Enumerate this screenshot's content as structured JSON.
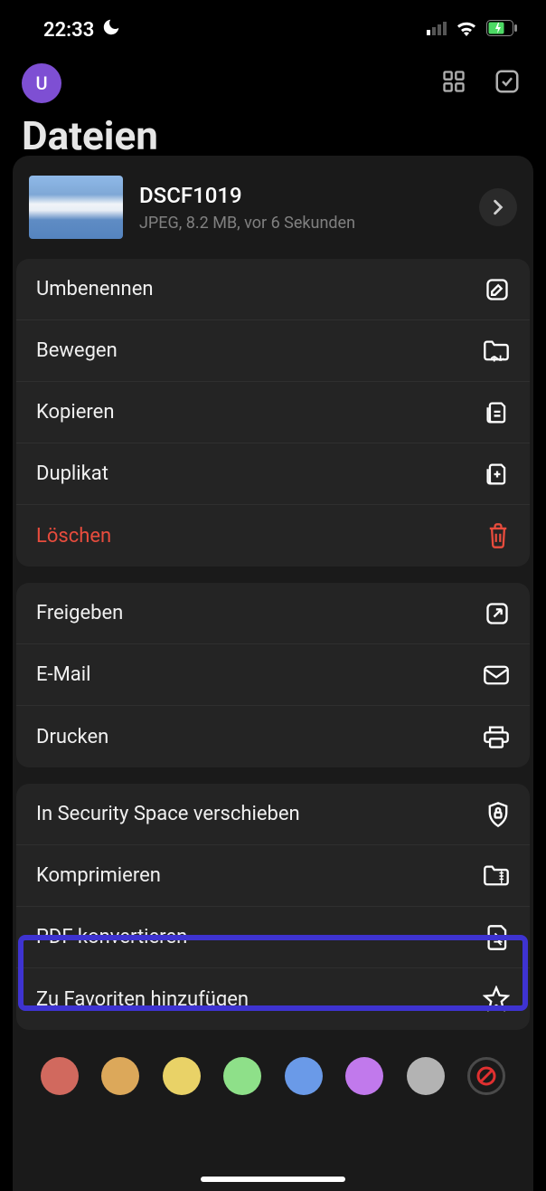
{
  "status": {
    "time": "22:33"
  },
  "avatar_letter": "U",
  "page_title": "Dateien",
  "file": {
    "name": "DSCF1019",
    "meta": "JPEG, 8.2 MB, vor 6 Sekunden"
  },
  "group1": {
    "rename": "Umbenennen",
    "move": "Bewegen",
    "copy": "Kopieren",
    "duplicate": "Duplikat",
    "delete": "Löschen"
  },
  "group2": {
    "share": "Freigeben",
    "email": "E-Mail",
    "print": "Drucken"
  },
  "group3": {
    "security": "In Security Space verschieben",
    "compress": "Komprimieren",
    "pdf": "PDF konvertieren",
    "favorite": "Zu Favoriten hinzufügen"
  },
  "colors": [
    "#d1695e",
    "#dca85a",
    "#e9d267",
    "#8ee089",
    "#6a9ae8",
    "#c179ec",
    "#b3b3b3"
  ]
}
